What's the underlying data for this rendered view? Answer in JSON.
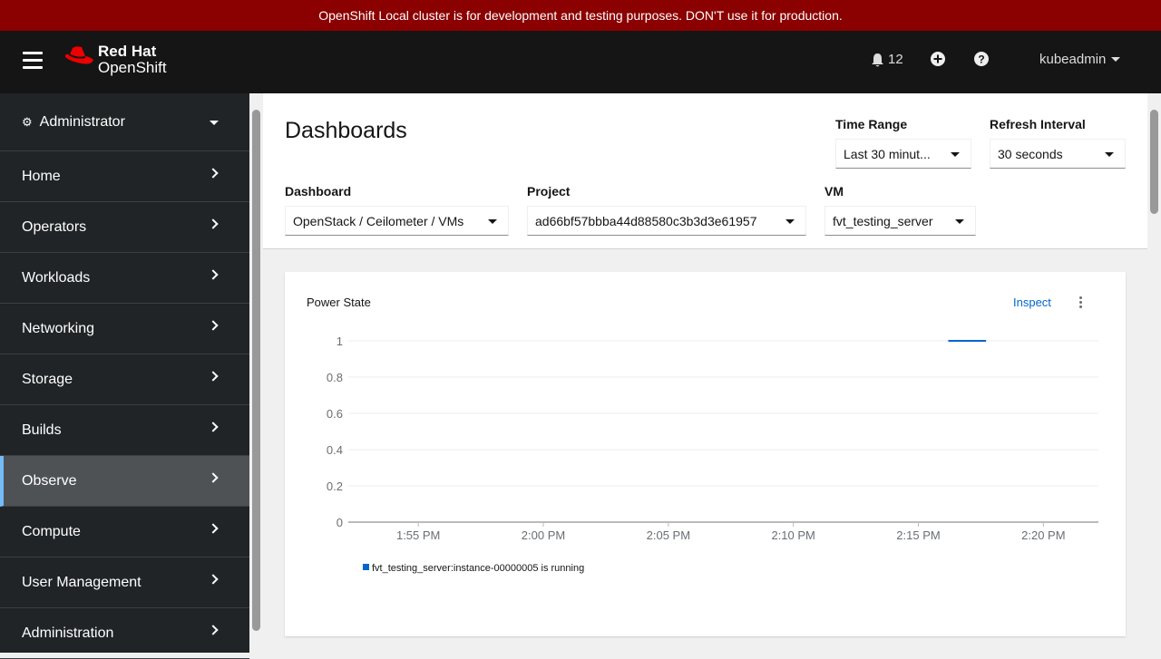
{
  "banner": "OpenShift Local cluster is for development and testing purposes. DON'T use it for production.",
  "brand": {
    "line1": "Red Hat",
    "line2": "OpenShift"
  },
  "masthead": {
    "notifications": "12",
    "user": "kubeadmin"
  },
  "sidebar": {
    "perspective": "Administrator",
    "items": [
      {
        "label": "Home"
      },
      {
        "label": "Operators"
      },
      {
        "label": "Workloads"
      },
      {
        "label": "Networking"
      },
      {
        "label": "Storage"
      },
      {
        "label": "Builds"
      },
      {
        "label": "Observe",
        "active": true
      },
      {
        "label": "Compute"
      },
      {
        "label": "User Management"
      },
      {
        "label": "Administration"
      }
    ]
  },
  "page": {
    "title": "Dashboards",
    "time_range": {
      "label": "Time Range",
      "value": "Last 30 minut..."
    },
    "refresh": {
      "label": "Refresh Interval",
      "value": "30 seconds"
    },
    "dashboard": {
      "label": "Dashboard",
      "value": "OpenStack / Ceilometer / VMs"
    },
    "project": {
      "label": "Project",
      "value": "ad66bf57bbba44d88580c3b3d3e61957"
    },
    "vm": {
      "label": "VM",
      "value": "fvt_testing_server"
    }
  },
  "card": {
    "title": "Power State",
    "inspect": "Inspect"
  },
  "colors": {
    "banner": "#8b0000",
    "series": "#0066cc",
    "link": "#0066cc"
  },
  "chart_data": {
    "type": "line",
    "title": "Power State",
    "xlabel": "",
    "ylabel": "",
    "ylim": [
      0,
      1
    ],
    "yticks": [
      "0",
      "0.2",
      "0.4",
      "0.6",
      "0.8",
      "1"
    ],
    "xlim_minutes": [
      832.2,
      862.2
    ],
    "xticks": [
      {
        "label": "1:55 PM",
        "m": 835
      },
      {
        "label": "2:00 PM",
        "m": 840
      },
      {
        "label": "2:05 PM",
        "m": 845
      },
      {
        "label": "2:10 PM",
        "m": 850
      },
      {
        "label": "2:15 PM",
        "m": 855
      },
      {
        "label": "2:20 PM",
        "m": 860
      }
    ],
    "series": [
      {
        "name": "fvt_testing_server:instance-00000005 is running",
        "x_minutes": [
          856.2,
          856.7,
          857.2,
          857.7
        ],
        "values": [
          1,
          1,
          1,
          1
        ]
      }
    ],
    "legend": "bottom-left",
    "grid": true
  }
}
